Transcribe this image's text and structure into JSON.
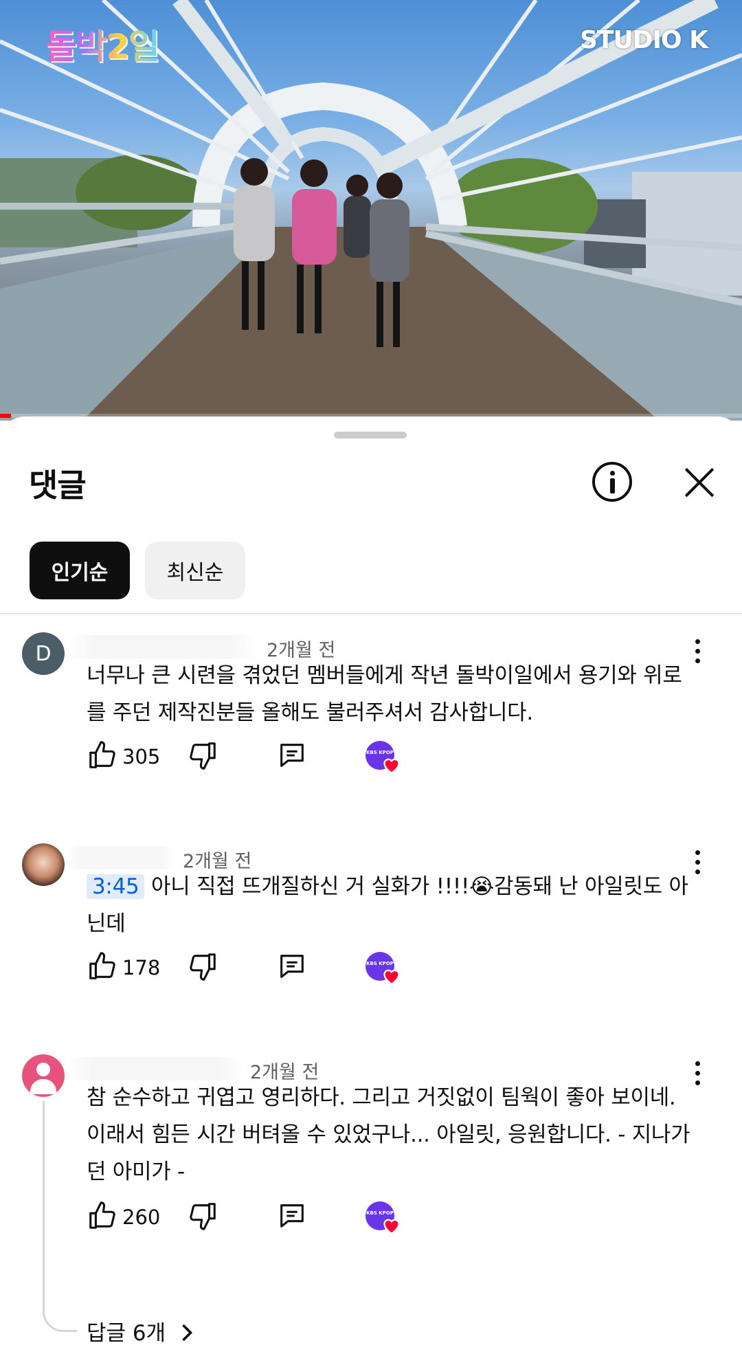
{
  "video": {
    "channel_logo": "돌박2일",
    "studio_logo": "STUDIO K",
    "progress_fraction": 0.015
  },
  "sheet": {
    "title": "댓글",
    "info_icon": "info-icon",
    "close_icon": "close-icon"
  },
  "sort": {
    "popular_label": "인기순",
    "newest_label": "최신순"
  },
  "comments": [
    {
      "avatar_letter": "D",
      "time": "2개월 전",
      "text": "너무나 큰 시련을 겪었던 멤버들에게 작년 돌박이일에서 용기와 위로를 주던 제작진분들 올해도 불러주셔서 감사합니다.",
      "likes": "305"
    },
    {
      "time": "2개월 전",
      "timestamp": "3:45",
      "text": "아니 직접 뜨개질하신 거 실화가 !!!!😭감동돼 난 아일릿도 아닌데",
      "likes": "178"
    },
    {
      "time": "2개월 전",
      "text": "참 순수하고 귀엽고 영리하다. 그리고 거짓없이 팀웍이 좋아 보이네. 이래서 힘든 시간 버텨올 수 있었구나...  아일릿, 응원합니다. - 지나가던 아미가 -",
      "likes": "260",
      "replies_label": "답글 6개"
    }
  ],
  "creator_heart": {
    "badge_text": "KBS KPOP",
    "heart_color": "#ff0033"
  }
}
